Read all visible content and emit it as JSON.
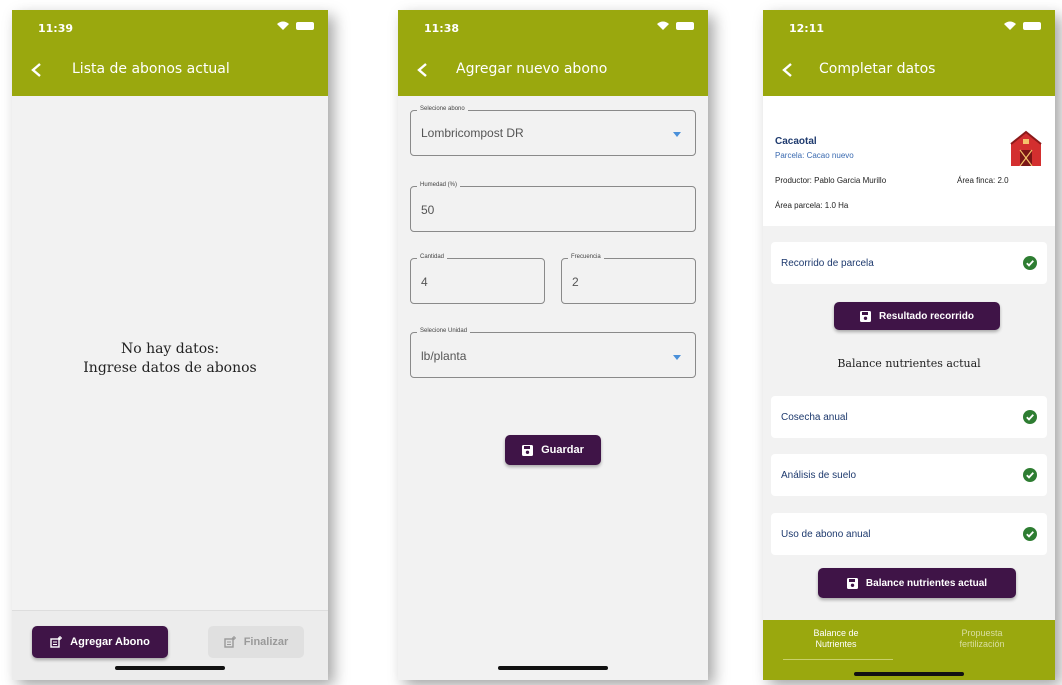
{
  "colors": {
    "appbar": "#9aa80e",
    "button_dark": "#3f1447",
    "text_link": "#1e3a6e",
    "check_green": "#2e7d32"
  },
  "screen1": {
    "time": "11:39",
    "title": "Lista de abonos actual",
    "empty_line1": "No hay datos:",
    "empty_line2": "Ingrese datos de abonos",
    "add_button": "Agregar Abono",
    "finish_button": "Finalizar"
  },
  "screen2": {
    "time": "11:38",
    "title": "Agregar nuevo abono",
    "fields": {
      "abono_label": "Selecione abono",
      "abono_value": "Lombricompost DR",
      "humedad_label": "Humedad (%)",
      "humedad_value": "50",
      "cantidad_label": "Cantidad",
      "cantidad_value": "4",
      "frecuencia_label": "Frecuencia",
      "frecuencia_value": "2",
      "unidad_label": "Selecione Unidad",
      "unidad_value": "lb/planta"
    },
    "save_button": "Guardar"
  },
  "screen3": {
    "time": "12:11",
    "title": "Completar datos",
    "info": {
      "name": "Cacaotal",
      "parcela": "Parcela: Cacao nuevo",
      "productor": "Productor: Pablo Garcia Murillo",
      "area_finca": "Área finca: 2.0",
      "area_parcela": "Área parcela: 1.0 Ha"
    },
    "rows": {
      "recorrido": "Recorrido de parcela",
      "cosecha": "Cosecha anual",
      "analisis": "Análisis de suelo",
      "uso_abono": "Uso de abono anual"
    },
    "buttons": {
      "resultado": "Resultado recorrido",
      "balance": "Balance nutrientes actual"
    },
    "section_title": "Balance nutrientes actual",
    "tabs": {
      "tab1_line1": "Balance de",
      "tab1_line2": "Nutrientes",
      "tab2_line1": "Propuesta",
      "tab2_line2": "fertilización"
    }
  }
}
